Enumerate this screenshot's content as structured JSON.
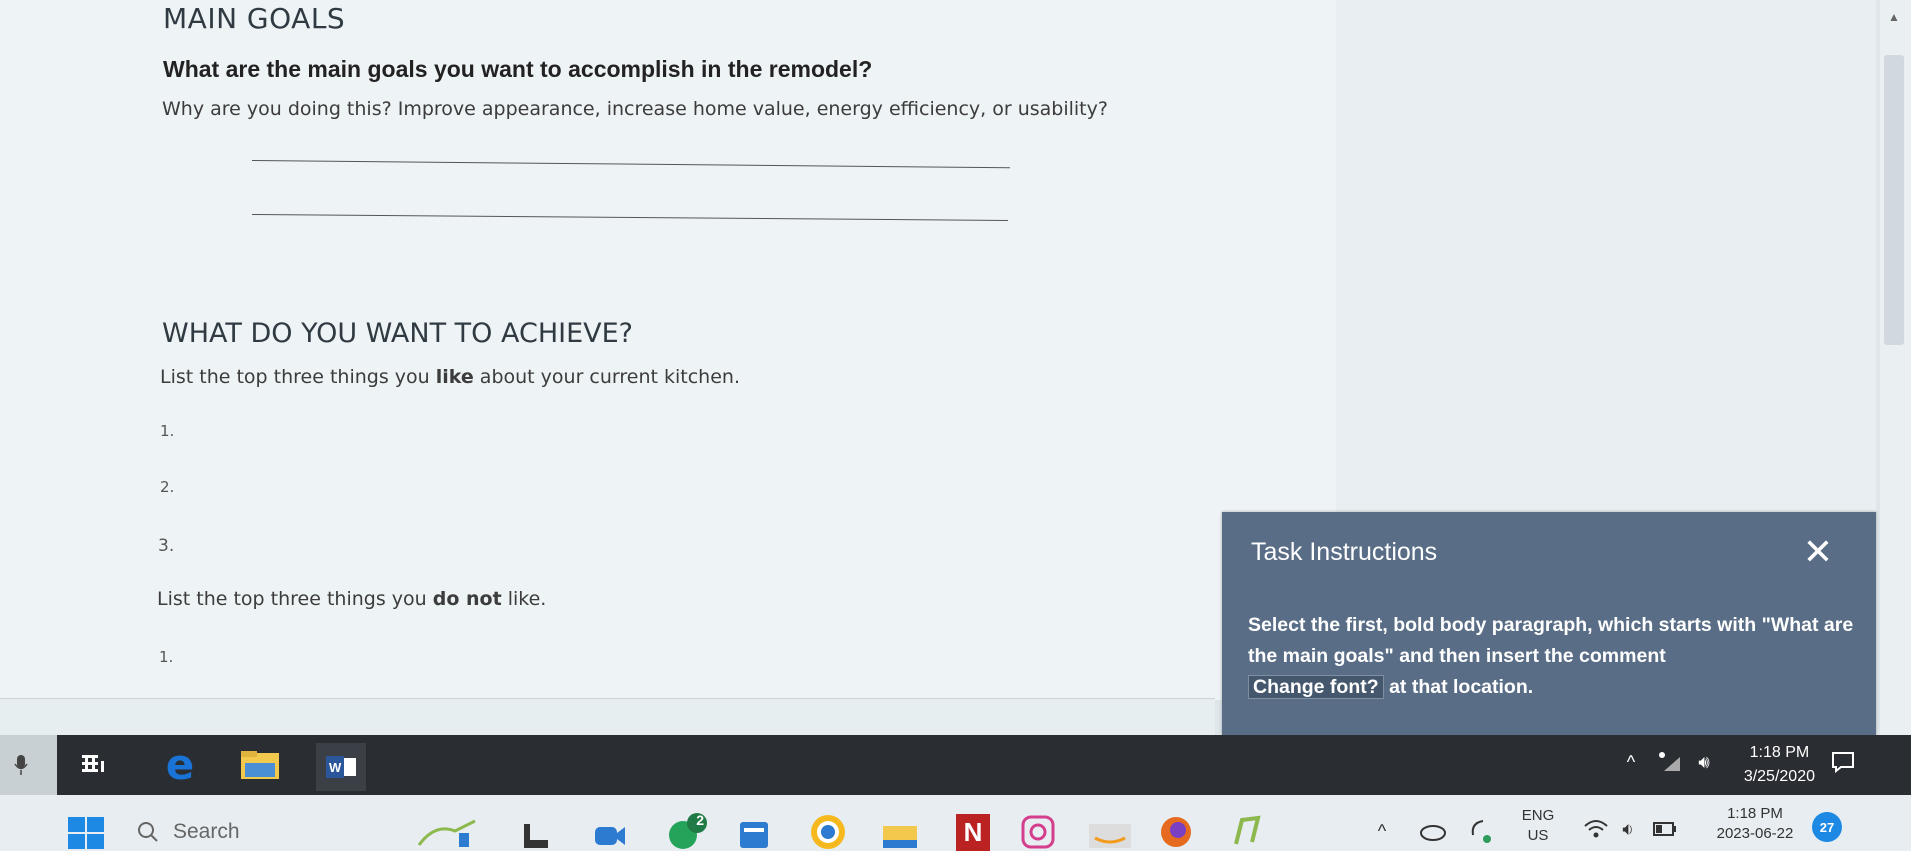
{
  "document": {
    "main_goals_heading": "MAIN GOALS",
    "main_goals_question": "What are the main goals you want to accomplish in the remodel?",
    "main_goals_sub": "Why are you doing this? Improve appearance, increase home value, energy efficiency, or usability?",
    "achieve_heading": "WHAT DO YOU WANT TO ACHIEVE?",
    "like_prefix": "List the top three things you ",
    "like_bold": "like",
    "like_suffix": " about your current kitchen.",
    "dislike_prefix": "List the top three things you ",
    "dislike_bold": "do not",
    "dislike_suffix": " like.",
    "list_numbers": [
      "1.",
      "2.",
      "3.",
      "1."
    ]
  },
  "task_panel": {
    "title": "Task Instructions",
    "close_label": "✕",
    "body_part1": "Select the first, bold body paragraph, which starts with \"What are the main goals\" and then insert the comment",
    "highlight": "Change font?",
    "body_part2": " at that location."
  },
  "inner_taskbar": {
    "time": "1:18 PM",
    "date": "3/25/2020"
  },
  "host_taskbar": {
    "search_placeholder": "Search",
    "language_top": "ENG",
    "language_bottom": "US",
    "time": "1:18 PM",
    "date": "2023-06-22",
    "notification_count": "27",
    "badge_count": "2",
    "accent_colors": {
      "windows_blue": "#1e88e5",
      "word_blue": "#2b579a",
      "edge_blue": "#1a73d6"
    }
  }
}
